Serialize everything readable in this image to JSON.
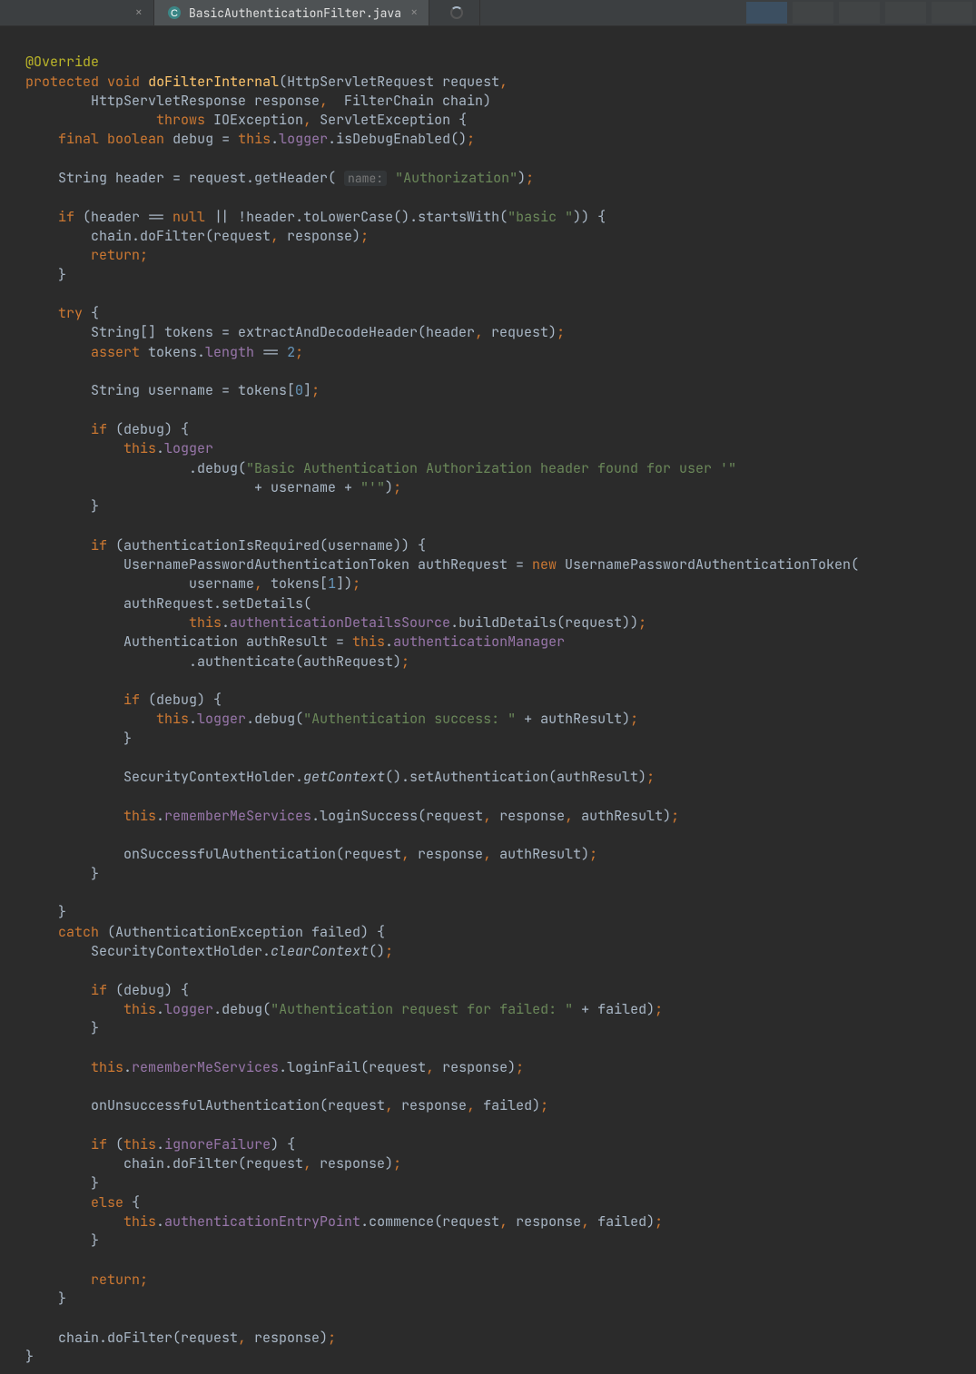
{
  "tabs": {
    "inactive_close": "×",
    "active_label": "BasicAuthenticationFilter.java",
    "active_close": "×"
  },
  "code": {
    "l1_ann": "@Override",
    "l2_kw1": "protected",
    "l2_kw2": "void",
    "l2_def": "doFilterInternal",
    "l2_t1": "(HttpServletRequest request",
    "l2_p1": ",",
    "l3_t": "HttpServletResponse response",
    "l3_p1": ",",
    "l3_t2": "  FilterChain chain)",
    "l4_kw": "throws",
    "l4_t": " IOException",
    "l4_p1": ",",
    "l4_t2": " ServletException {",
    "l5_kw1": "final",
    "l5_kw2": "boolean",
    "l5_t1": " debug = ",
    "l5_kw3": "this",
    "l5_t2": ".",
    "l5_f": "logger",
    "l5_t3": ".isDebugEnabled()",
    "l5_p": ";",
    "l7_t1": "String header = request.getHeader(",
    "l7_h": "name:",
    "l7_s": "\"Authorization\"",
    "l7_t2": ")",
    "l7_p": ";",
    "l9_kw": "if",
    "l9_t1": " (header == ",
    "l9_kw2": "null",
    "l9_t2": " || !header.toLowerCase().startsWith(",
    "l9_s": "\"basic \"",
    "l9_t3": ")) {",
    "l10_t": "chain.doFilter(request",
    "l10_p1": ",",
    "l10_t2": " response)",
    "l10_p2": ";",
    "l11_kw": "return;",
    "l12_t": "}",
    "l14_kw": "try",
    "l14_t": " {",
    "l15_t": "String[] tokens = extractAndDecodeHeader(header",
    "l15_p1": ",",
    "l15_t2": " request)",
    "l15_p2": ";",
    "l16_kw": "assert",
    "l16_t": " tokens.",
    "l16_f": "length",
    "l16_t2": " == ",
    "l16_n": "2",
    "l16_p": ";",
    "l18_t": "String username = tokens[",
    "l18_n": "0",
    "l18_t2": "]",
    "l18_p": ";",
    "l20_kw": "if",
    "l20_t": " (debug) {",
    "l21_kw": "this",
    "l21_t": ".",
    "l21_f": "logger",
    "l22_t": ".debug(",
    "l22_s": "\"Basic Authentication Authorization header found for user '\"",
    "l23_t": "+ username + ",
    "l23_s": "\"'\"",
    "l23_t2": ")",
    "l23_p": ";",
    "l24_t": "}",
    "l26_kw": "if",
    "l26_t": " (authenticationIsRequired(username)) {",
    "l27_t": "UsernamePasswordAuthenticationToken authRequest = ",
    "l27_kw": "new",
    "l27_t2": " UsernamePasswordAuthenticationToken(",
    "l28_t": "username",
    "l28_p1": ",",
    "l28_t2": " tokens[",
    "l28_n": "1",
    "l28_t3": "])",
    "l28_p2": ";",
    "l29_t": "authRequest.setDetails(",
    "l30_kw": "this",
    "l30_t": ".",
    "l30_f": "authenticationDetailsSource",
    "l30_t2": ".buildDetails(request))",
    "l30_p": ";",
    "l31_t": "Authentication authResult = ",
    "l31_kw": "this",
    "l31_t2": ".",
    "l31_f": "authenticationManager",
    "l32_t": ".authenticate(authRequest)",
    "l32_p": ";",
    "l34_kw": "if",
    "l34_t": " (debug) {",
    "l35_kw": "this",
    "l35_t1": ".",
    "l35_f": "logger",
    "l35_t2": ".debug(",
    "l35_s": "\"Authentication success: \"",
    "l35_t3": " + authResult)",
    "l35_p": ";",
    "l36_t": "}",
    "l38_t1": "SecurityContextHolder.",
    "l38_i": "getContext",
    "l38_t2": "().setAuthentication(authResult)",
    "l38_p": ";",
    "l40_kw": "this",
    "l40_t1": ".",
    "l40_f": "rememberMeServices",
    "l40_t2": ".loginSuccess(request",
    "l40_p1": ",",
    "l40_t3": " response",
    "l40_p2": ",",
    "l40_t4": " authResult)",
    "l40_p3": ";",
    "l42_t": "onSuccessfulAuthentication(request",
    "l42_p1": ",",
    "l42_t2": " response",
    "l42_p2": ",",
    "l42_t3": " authResult)",
    "l42_p3": ";",
    "l43_t": "}",
    "l45_t": "}",
    "l46_kw": "catch",
    "l46_t": " (AuthenticationException failed) {",
    "l47_t1": "SecurityContextHolder.",
    "l47_i": "clearContext",
    "l47_t2": "()",
    "l47_p": ";",
    "l49_kw": "if",
    "l49_t": " (debug) {",
    "l50_kw": "this",
    "l50_t1": ".",
    "l50_f": "logger",
    "l50_t2": ".debug(",
    "l50_s": "\"Authentication request for failed: \"",
    "l50_t3": " + failed)",
    "l50_p": ";",
    "l51_t": "}",
    "l53_kw": "this",
    "l53_t1": ".",
    "l53_f": "rememberMeServices",
    "l53_t2": ".loginFail(request",
    "l53_p1": ",",
    "l53_t3": " response)",
    "l53_p2": ";",
    "l55_t": "onUnsuccessfulAuthentication(request",
    "l55_p1": ",",
    "l55_t2": " response",
    "l55_p2": ",",
    "l55_t3": " failed)",
    "l55_p3": ";",
    "l57_kw": "if",
    "l57_t1": " (",
    "l57_kw2": "this",
    "l57_t2": ".",
    "l57_f": "ignoreFailure",
    "l57_t3": ") {",
    "l58_t": "chain.doFilter(request",
    "l58_p1": ",",
    "l58_t2": " response)",
    "l58_p2": ";",
    "l59_t": "}",
    "l60_kw": "else",
    "l60_t": " {",
    "l61_kw": "this",
    "l61_t1": ".",
    "l61_f": "authenticationEntryPoint",
    "l61_t2": ".commence(request",
    "l61_p1": ",",
    "l61_t3": " response",
    "l61_p2": ",",
    "l61_t4": " failed)",
    "l61_p3": ";",
    "l62_t": "}",
    "l64_kw": "return;",
    "l65_t": "}",
    "l67_t": "chain.doFilter(request",
    "l67_p1": ",",
    "l67_t2": " response)",
    "l67_p2": ";",
    "l68_t": "}"
  }
}
